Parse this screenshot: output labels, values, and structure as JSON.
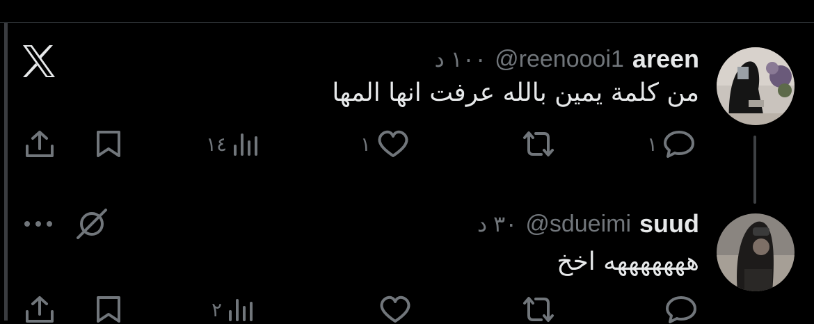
{
  "icons": {
    "logo": "x-logo-icon",
    "share": "share-icon",
    "bookmark": "bookmark-icon",
    "views": "views-icon",
    "like": "heart-icon",
    "retweet": "retweet-icon",
    "reply": "reply-icon",
    "more": "more-icon",
    "grok": "grok-icon"
  },
  "colors": {
    "background": "#000000",
    "primary_text": "#e7e9ea",
    "secondary_text": "#71767b"
  },
  "tweets": [
    {
      "name": "areen",
      "handle": "@reenoooi1",
      "time": "١٠٠ د",
      "text": "من كلمة يمين بالله عرفت انها المها",
      "replies": "١",
      "likes": "١",
      "views": "١٤"
    },
    {
      "name": "suud",
      "handle": "@sdueimi",
      "time": "٣٠ د",
      "text": "هههههههه اخخ",
      "views": "٢"
    }
  ]
}
